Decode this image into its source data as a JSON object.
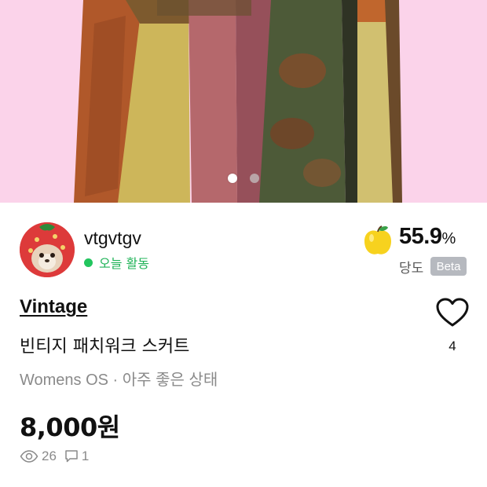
{
  "product_image": {
    "current_index": 1,
    "total": 2
  },
  "seller": {
    "name": "vtgvtgv",
    "activity": "오늘 활동",
    "activity_color": "#22c55e"
  },
  "sweetness": {
    "value": "55.9",
    "unit": "%",
    "label": "당도",
    "badge": "Beta",
    "icon": "yellow-apple-icon"
  },
  "product": {
    "brand": "Vintage",
    "title": "빈티지 패치워크 스커트",
    "meta": "Womens OS · 아주 좋은 상태",
    "price": "8,000원"
  },
  "like": {
    "icon": "heart-outline-icon",
    "count": "4"
  },
  "stats": {
    "views": "26",
    "comments": "1",
    "view_icon": "eye-icon",
    "comment_icon": "comment-icon"
  },
  "colors": {
    "background_pink": "#fbd3ea",
    "price_text": "#111111",
    "muted_text": "#8a8a8a"
  }
}
